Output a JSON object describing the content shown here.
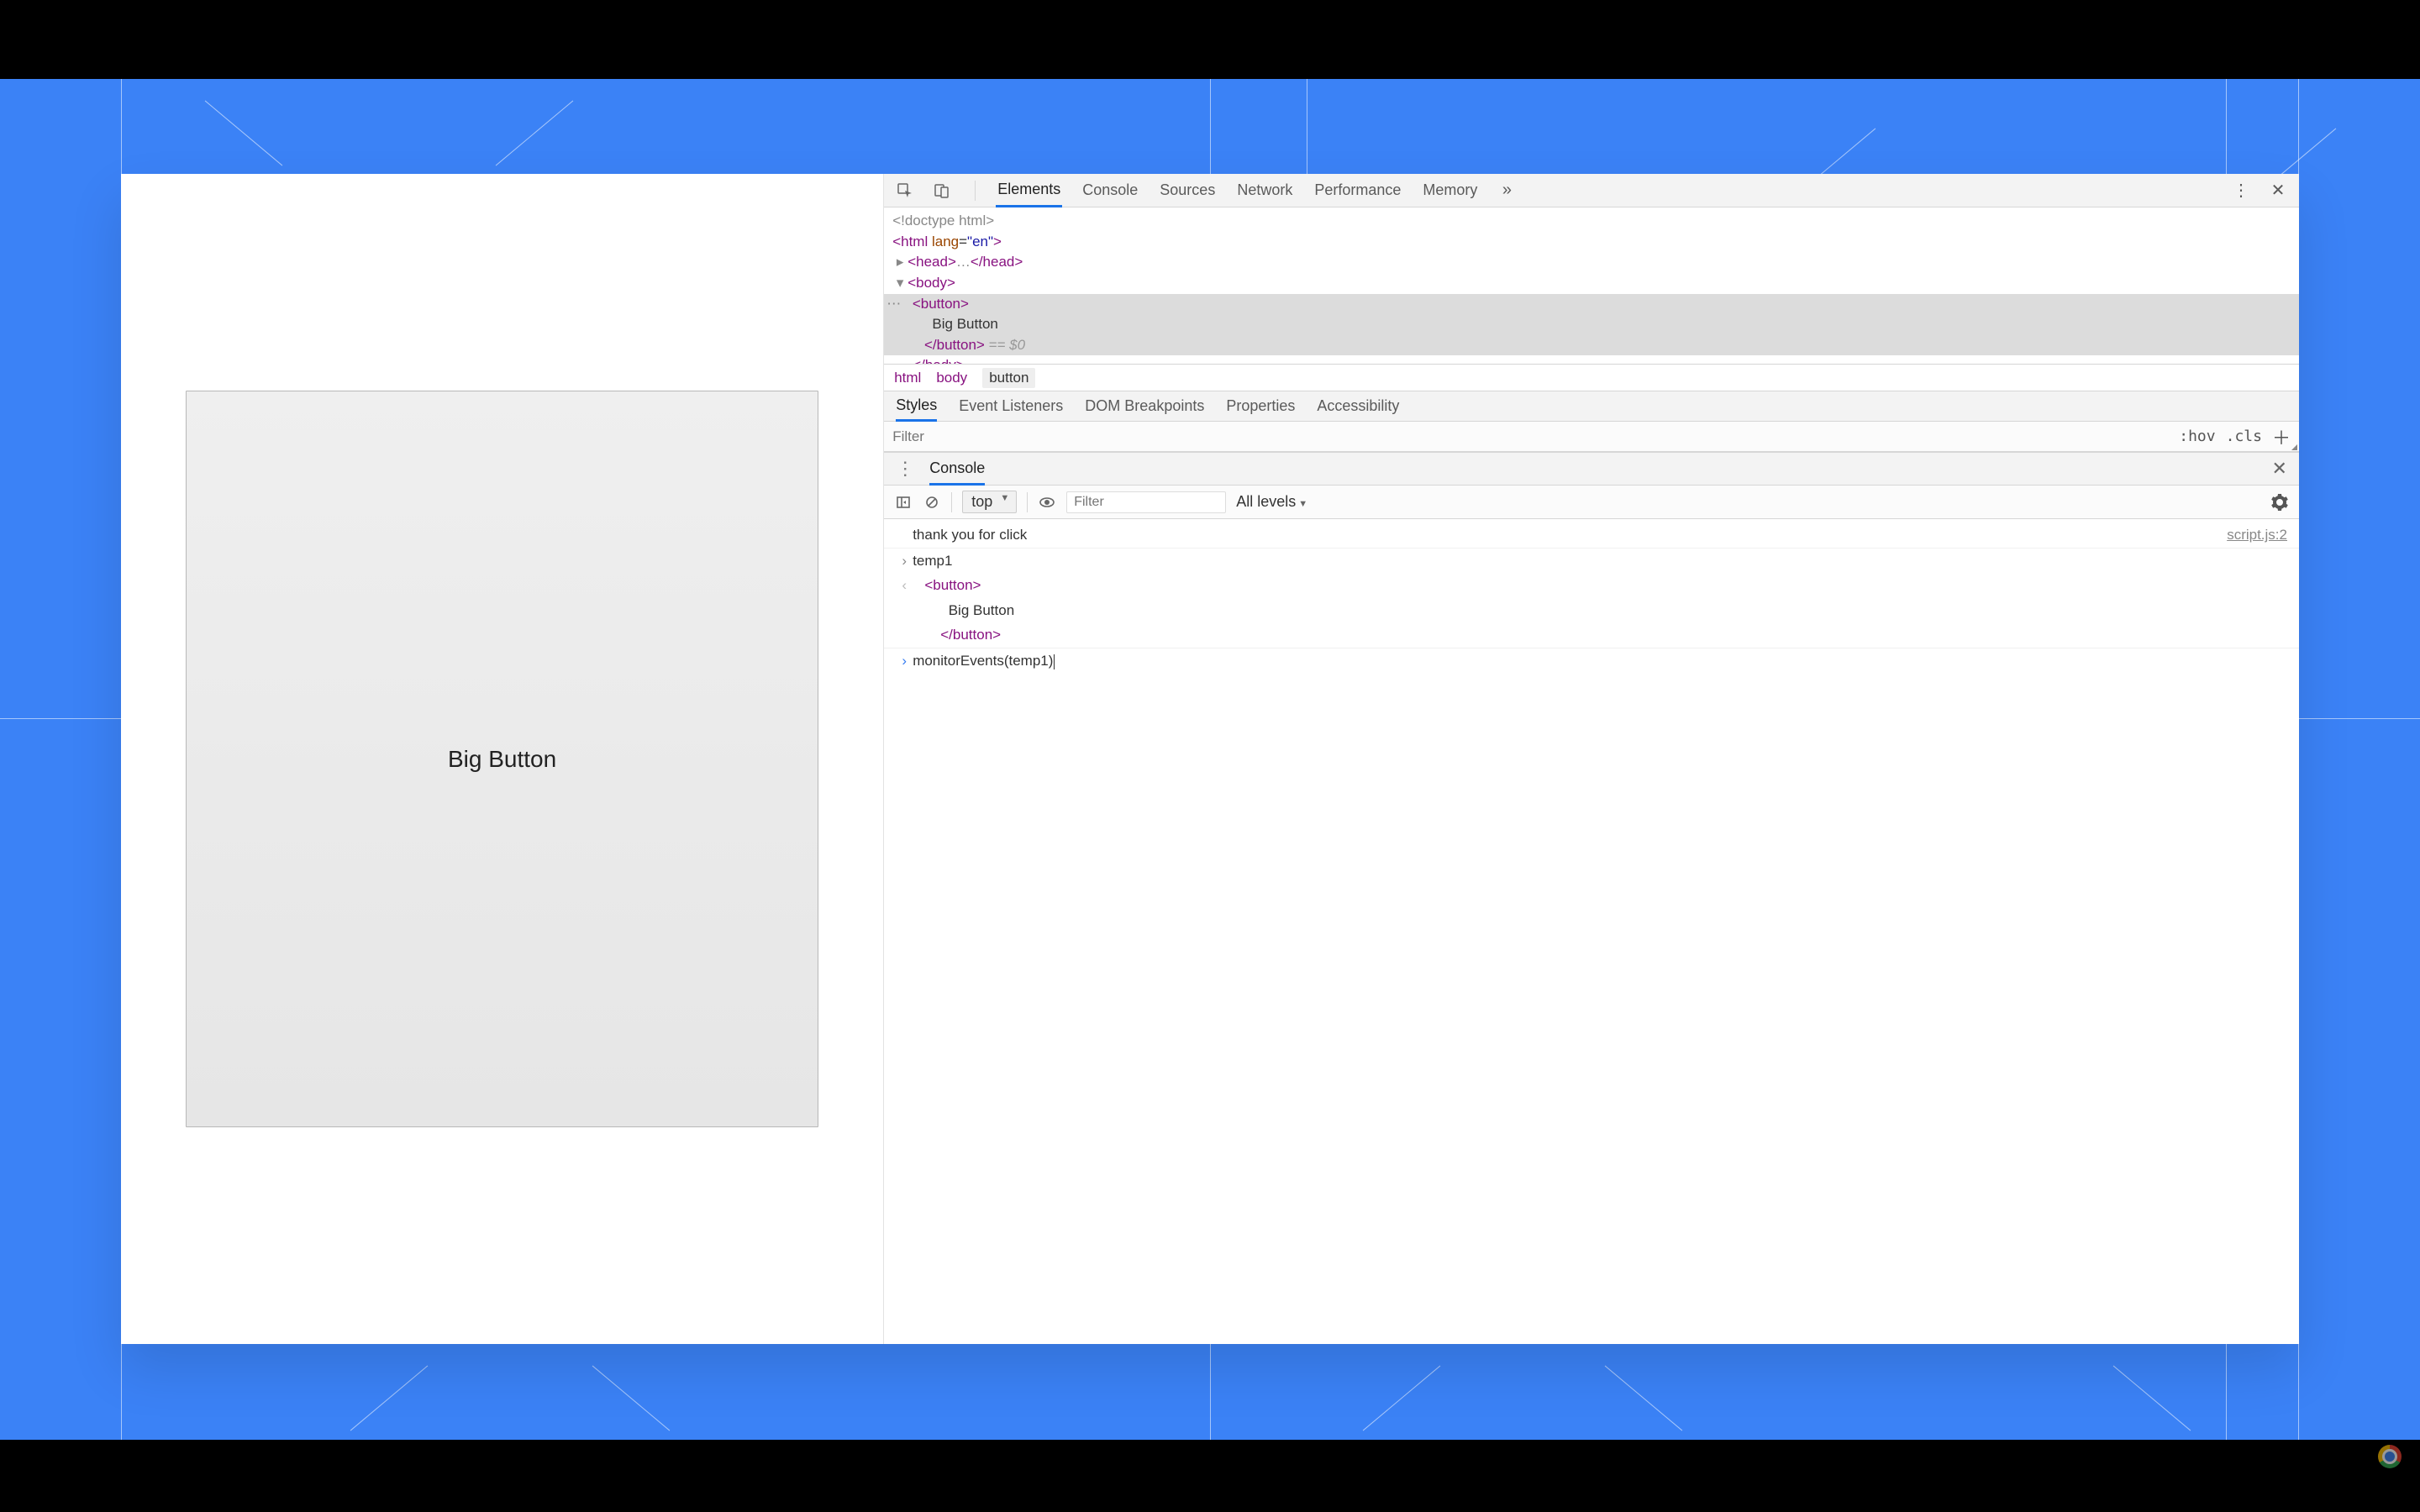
{
  "page": {
    "button_label": "Big Button"
  },
  "devtools": {
    "tabs": [
      "Elements",
      "Console",
      "Sources",
      "Network",
      "Performance",
      "Memory"
    ],
    "active_tab": "Elements",
    "dom": {
      "doctype": "<!doctype html>",
      "html_open": "<html lang=\"en\">",
      "head_collapsed_prefix": "<head>",
      "head_collapsed_mid": "…",
      "head_collapsed_suffix": "</head>",
      "body_open": "<body>",
      "button_open": "<button>",
      "button_text": "Big Button",
      "button_close": "</button>",
      "dollar0": " == $0",
      "body_close_partial": "</body>"
    },
    "breadcrumb": [
      "html",
      "body",
      "button"
    ],
    "subtabs": [
      "Styles",
      "Event Listeners",
      "DOM Breakpoints",
      "Properties",
      "Accessibility"
    ],
    "active_subtab": "Styles",
    "styles_filter_placeholder": "Filter",
    "hov_label": ":hov",
    "cls_label": ".cls"
  },
  "console_drawer": {
    "title": "Console",
    "context": "top",
    "filter_placeholder": "Filter",
    "levels": "All levels",
    "log": {
      "msg": "thank you for click",
      "source": "script.js:2"
    },
    "entries": {
      "input1": "temp1",
      "output1_l1": "<button>",
      "output1_l2": "Big Button",
      "output1_l3": "</button>",
      "prompt": "monitorEvents(temp1)"
    }
  }
}
